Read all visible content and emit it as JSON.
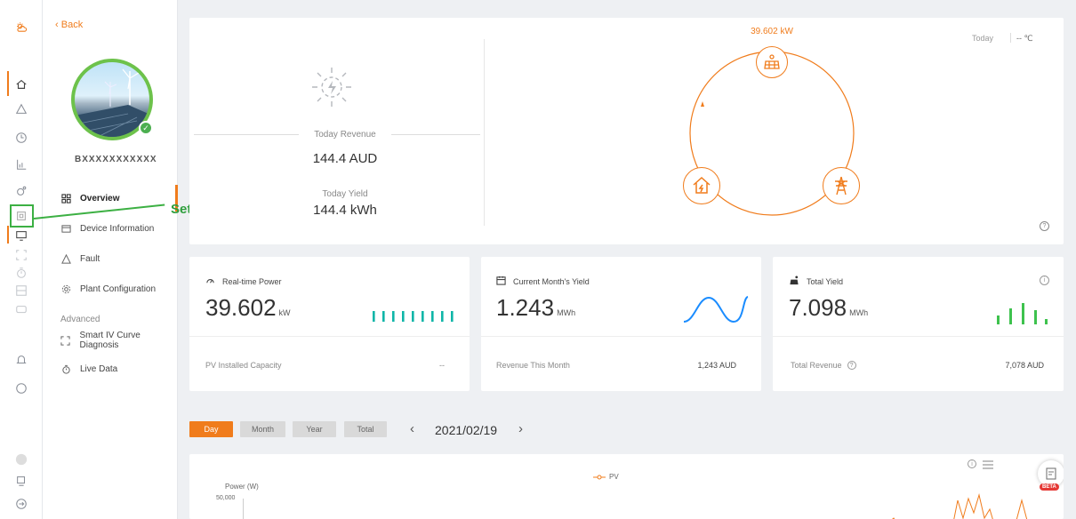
{
  "nav": {
    "back_label": "Back",
    "plant_name": "BXXXXXXXXXXX",
    "items": [
      {
        "label": "Overview",
        "icon": "grid-icon"
      },
      {
        "label": "Device Information",
        "icon": "device-icon"
      },
      {
        "label": "Fault",
        "icon": "warning-icon"
      },
      {
        "label": "Plant Configuration",
        "icon": "gear-icon"
      }
    ],
    "advanced_label": "Advanced",
    "advanced_items": [
      {
        "label": "Smart IV Curve Diagnosis",
        "icon": "iv-curve-icon"
      },
      {
        "label": "Live Data",
        "icon": "stopwatch-icon"
      }
    ]
  },
  "annotation": {
    "label": "Settings",
    "color": "#2e9e3c"
  },
  "summary": {
    "today_revenue_label": "Today Revenue",
    "today_revenue_value": "144.4 AUD",
    "today_yield_label": "Today Yield",
    "today_yield_value": "144.4 kWh"
  },
  "flow": {
    "power_label": "39.602 kW",
    "today_label": "Today",
    "temp_label": "-- ℃",
    "accent": "#f07c1c"
  },
  "stats": [
    {
      "title": "Real-time Power",
      "value": "39.602",
      "unit": "kW",
      "sub_label": "PV Installed Capacity",
      "sub_value": "--"
    },
    {
      "title": "Current Month's Yield",
      "value": "1.243",
      "unit": "MWh",
      "sub_label": "Revenue This Month",
      "sub_value": "1,243 AUD"
    },
    {
      "title": "Total Yield",
      "value": "7.098",
      "unit": "MWh",
      "sub_label": "Total Revenue",
      "sub_value": "7,078 AUD"
    }
  ],
  "period_tabs": [
    "Day",
    "Month",
    "Year",
    "Total"
  ],
  "date": "2021/02/19",
  "chart": {
    "legend": "PV",
    "ylabel": "Power (W)",
    "ytick_top": "50,000",
    "beta_label": "BETA"
  }
}
